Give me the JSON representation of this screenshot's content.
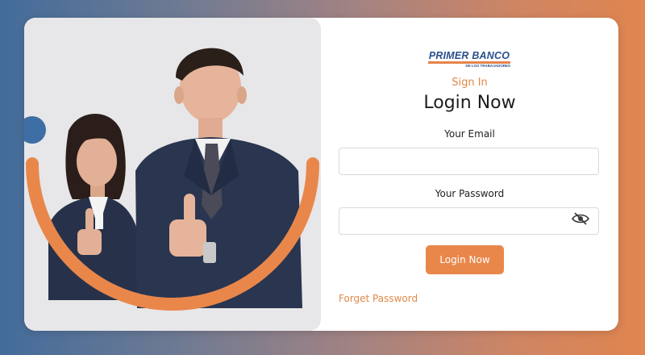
{
  "brand": {
    "name": "PRIMER BANCO",
    "tagline": "DE LOS TRABAJADORES"
  },
  "form": {
    "kicker": "Sign In",
    "heading": "Login Now",
    "email_label": "Your Email",
    "email_value": "",
    "password_label": "Your Password",
    "password_value": "",
    "submit_label": "Login Now",
    "forget_label": "Forget Password"
  },
  "icons": {
    "password_toggle": "eye-slash-icon"
  },
  "colors": {
    "accent": "#e9874b",
    "brand_blue": "#2a4f8c",
    "circle_blue": "#3d6ea5",
    "panel_bg": "#e7e7e9"
  }
}
